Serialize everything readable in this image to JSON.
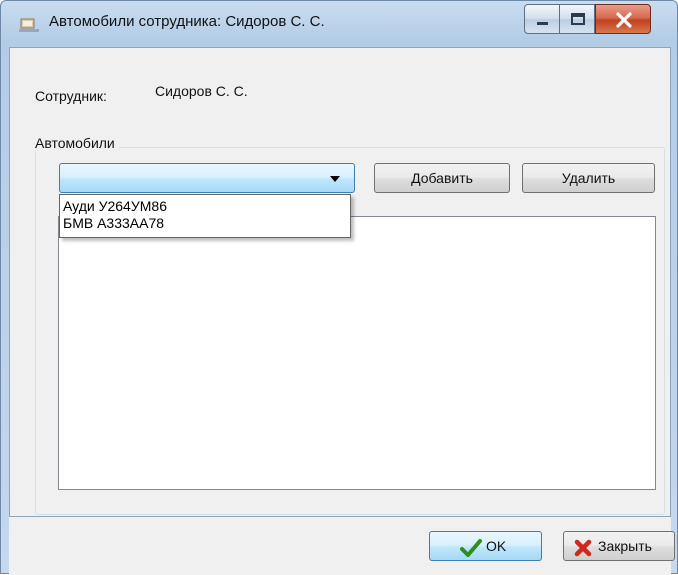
{
  "window": {
    "title": "Автомобили сотрудника: Сидоров С. С.",
    "icon": "car-app-icon",
    "controls": [
      "minimize",
      "maximize",
      "close"
    ]
  },
  "employee": {
    "label": "Сотрудник:",
    "value": "Сидоров С. С."
  },
  "cars_group": {
    "title": "Автомобили",
    "combo_value": "",
    "dropdown_items": [
      "Ауди У264УМ86",
      "БМВ А333АА78"
    ],
    "add_label": "Добавить",
    "delete_label": "Удалить",
    "list_items": []
  },
  "footer": {
    "ok_label": "OK",
    "close_label": "Закрыть",
    "ok_icon": "checkmark-icon",
    "close_icon": "red-x-icon"
  },
  "colors": {
    "accent": "#3c7fb1",
    "close_button": "#c2411f",
    "ok_icon": "#2f8f1d",
    "close_icon": "#d2281b"
  }
}
